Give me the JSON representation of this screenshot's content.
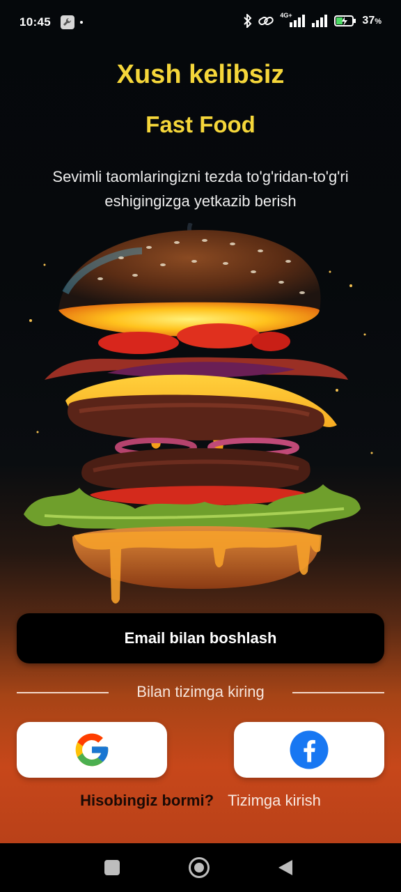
{
  "status_bar": {
    "time": "10:45",
    "battery_percent": "37",
    "battery_symbol": "%",
    "network_label": "4G+",
    "icons": [
      "wrench-icon",
      "bluetooth-icon",
      "link-icon",
      "signal-icon",
      "battery-icon"
    ]
  },
  "welcome": {
    "title": "Xush kelibsiz",
    "subtitle": "Fast Food",
    "description": "Sevimli taomlaringizni tezda to'g'ridan-to'g'ri eshigingizga yetkazib berish"
  },
  "hero_image": {
    "icon": "burger-image"
  },
  "actions": {
    "email_button": "Email bilan boshlash",
    "divider_text": "Bilan tizimga kiring",
    "google_icon": "google-icon",
    "facebook_icon": "facebook-icon",
    "account_question": "Hisobingiz bormi?",
    "login_link": "Tizimga kirish"
  },
  "colors": {
    "accent_yellow": "#f5d63a",
    "button_black": "#000000",
    "background_orange": "#c7471a",
    "facebook_blue": "#1877f2"
  },
  "navigation": {
    "icons": [
      "recents-square-icon",
      "home-circle-icon",
      "back-triangle-icon"
    ]
  }
}
